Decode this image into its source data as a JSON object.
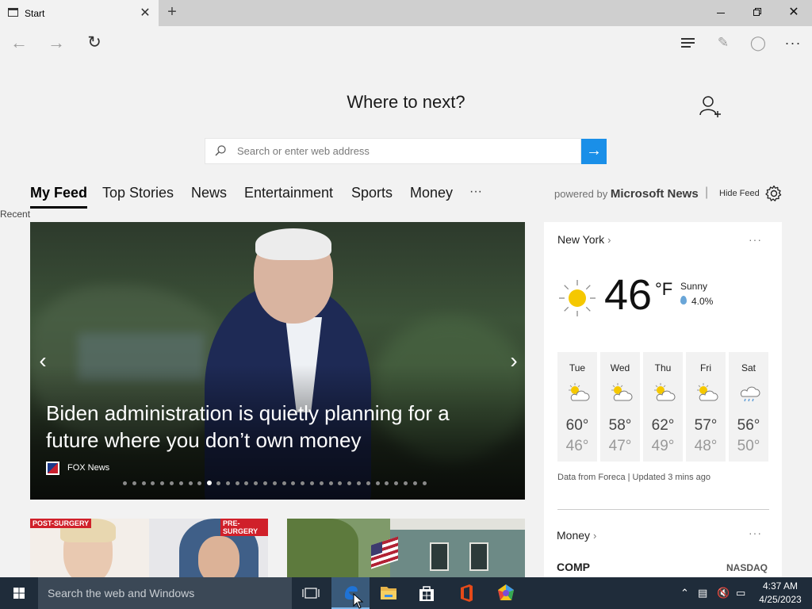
{
  "browser": {
    "tab_title": "Start",
    "close_tab": "✕",
    "new_tab": "+",
    "window_close": "✕"
  },
  "start": {
    "heading": "Where to next?",
    "search_placeholder": "Search or enter web address",
    "go_arrow": "→"
  },
  "feed": {
    "tabs": [
      "My Feed",
      "Top Stories",
      "News",
      "Entertainment",
      "Sports",
      "Money"
    ],
    "more": "···",
    "powered_prefix": "powered by",
    "powered_brand": "Microsoft News",
    "separator": "|",
    "hide_feed": "Hide Feed",
    "recent": "Recent"
  },
  "hero": {
    "headline": "Biden administration is quietly planning for a future where you don’t own money",
    "source": "FOX News",
    "dot_count": 33,
    "active_dot": 9
  },
  "cards": {
    "post_surgery": "POST-SURGERY",
    "pre_surgery": "PRE-SURGERY"
  },
  "weather": {
    "location": "New York",
    "more": "···",
    "temp": "46",
    "unit": "°F",
    "condition": "Sunny",
    "precip": "4.0%",
    "days": [
      {
        "name": "Tue",
        "hi": "60°",
        "lo": "46°",
        "icon": "partly-sunny-icon"
      },
      {
        "name": "Wed",
        "hi": "58°",
        "lo": "47°",
        "icon": "partly-sunny-icon"
      },
      {
        "name": "Thu",
        "hi": "62°",
        "lo": "49°",
        "icon": "partly-sunny-icon"
      },
      {
        "name": "Fri",
        "hi": "57°",
        "lo": "48°",
        "icon": "partly-sunny-icon"
      },
      {
        "name": "Sat",
        "hi": "56°",
        "lo": "50°",
        "icon": "rain-icon"
      }
    ],
    "footnote": "Data from Foreca | Updated 3 mins ago"
  },
  "money": {
    "title": "Money",
    "more": "···",
    "symbol": "COMP",
    "exchange": "NASDAQ"
  },
  "taskbar": {
    "search_text": "Search the web and Windows",
    "time": "4:37 AM",
    "date": "4/25/2023"
  },
  "colors": {
    "accent": "#1a8fe8",
    "taskbar": "#1f2c3a",
    "sun": "#f5c800"
  }
}
